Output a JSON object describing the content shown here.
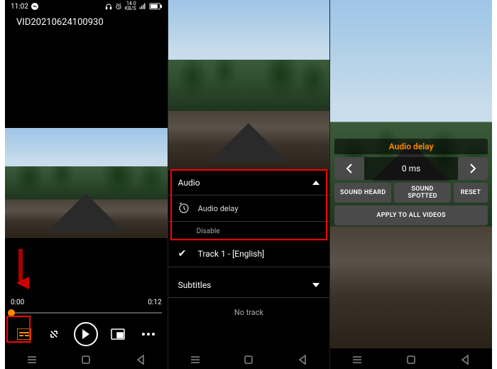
{
  "pane1": {
    "status": {
      "time": "11:02",
      "net_kbps": "14.0",
      "net_unit": "KB/S"
    },
    "video_title": "VID20210624100930",
    "time_current": "0:00",
    "time_total": "0:12"
  },
  "pane2": {
    "audio_header": "Audio",
    "audio_delay_label": "Audio delay",
    "disable_label": "Disable",
    "track_label": "Track 1 - [English]",
    "subtitles_header": "Subtitles",
    "no_track_label": "No track"
  },
  "pane3": {
    "title": "Audio delay",
    "value": "0 ms",
    "buttons": {
      "sound_heard": "SOUND HEARD",
      "sound_spotted": "SOUND SPOTTED",
      "reset": "RESET",
      "apply_all": "APPLY TO ALL VIDEOS"
    }
  }
}
